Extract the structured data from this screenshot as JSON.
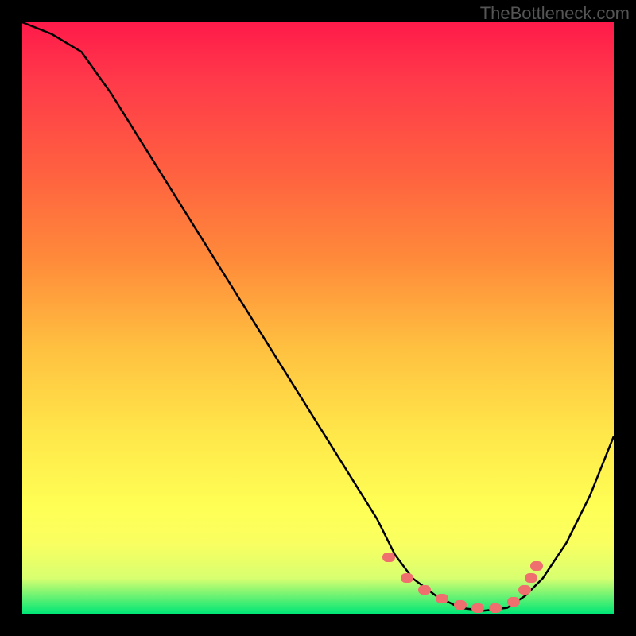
{
  "watermark": "TheBottleneck.com",
  "chart_data": {
    "type": "line",
    "title": "",
    "xlabel": "",
    "ylabel": "",
    "xlim": [
      0,
      100
    ],
    "ylim": [
      0,
      100
    ],
    "series": [
      {
        "name": "curve",
        "x": [
          0,
          5,
          10,
          15,
          20,
          25,
          30,
          35,
          40,
          45,
          50,
          55,
          60,
          63,
          66,
          70,
          74,
          78,
          82,
          85,
          88,
          92,
          96,
          100
        ],
        "y": [
          100,
          98,
          95,
          88,
          80,
          72,
          64,
          56,
          48,
          40,
          32,
          24,
          16,
          10,
          6,
          3,
          1,
          0.5,
          1,
          3,
          6,
          12,
          20,
          30
        ]
      }
    ],
    "highlight_dots": {
      "name": "trough-dots",
      "x": [
        62,
        65,
        68,
        71,
        74,
        77,
        80,
        83,
        85,
        86,
        87
      ],
      "y": [
        9.5,
        6,
        4,
        2.5,
        1.5,
        1,
        1,
        2,
        4,
        6,
        8
      ]
    },
    "background_gradient": {
      "top": "#ff1a4a",
      "mid": "#ffe84a",
      "bottom": "#00e676"
    }
  }
}
